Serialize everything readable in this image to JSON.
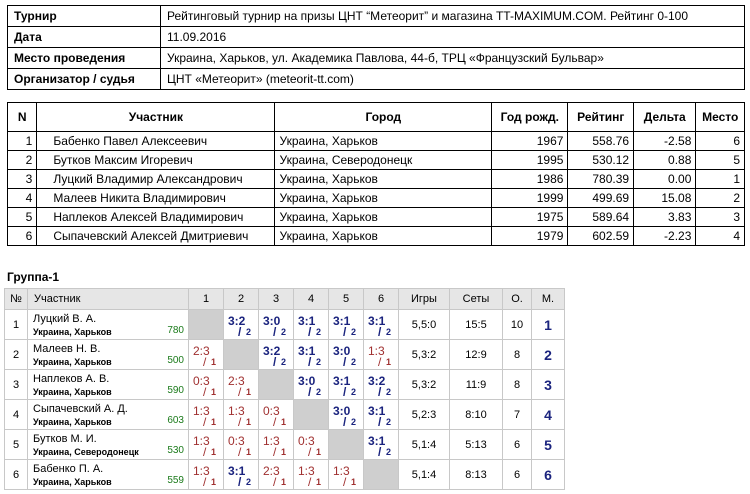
{
  "info": [
    {
      "key": "Турнир",
      "value": "Рейтинговый турнир на призы ЦНТ “Метеорит” и магазина TT-MAXIMUM.COM. Рейтинг 0-100"
    },
    {
      "key": "Дата",
      "value": "11.09.2016"
    },
    {
      "key": "Место проведения",
      "value": "Украина, Харьков, ул. Академика Павлова, 44-б, ТРЦ «Французский Бульвар»"
    },
    {
      "key": "Организатор / судья",
      "value": "ЦНТ «Метеорит» (meteorit-tt.com)"
    }
  ],
  "participants": {
    "headers": [
      "N",
      "Участник",
      "Город",
      "Год рожд.",
      "Рейтинг",
      "Дельта",
      "Место"
    ],
    "rows": [
      [
        "1",
        "Бабенко Павел Алексеевич",
        "Украина, Харьков",
        "1967",
        "558.76",
        "-2.58",
        "6"
      ],
      [
        "2",
        "Бутков Максим Игоревич",
        "Украина, Северодонецк",
        "1995",
        "530.12",
        "0.88",
        "5"
      ],
      [
        "3",
        "Луцкий Владимир Александрович",
        "Украина, Харьков",
        "1986",
        "780.39",
        "0.00",
        "1"
      ],
      [
        "4",
        "Малеев Никита Владимирович",
        "Украина, Харьков",
        "1999",
        "499.69",
        "15.08",
        "2"
      ],
      [
        "5",
        "Наплеков Алексей Владимирович",
        "Украина, Харьков",
        "1975",
        "589.64",
        "3.83",
        "3"
      ],
      [
        "6",
        "Сыпачевский Алексей Дмитриевич",
        "Украина, Харьков",
        "1979",
        "602.59",
        "-2.23",
        "4"
      ]
    ]
  },
  "group": {
    "title": "Группа-1",
    "headers": [
      "№",
      "Участник",
      "1",
      "2",
      "3",
      "4",
      "5",
      "6",
      "Игры",
      "Сеты",
      "О.",
      "М."
    ],
    "rows": [
      {
        "n": "1",
        "name": "Луцкий В. А.",
        "city": "Украина, Харьков",
        "rating": "780",
        "cells": [
          null,
          [
            "3:2",
            "2",
            "w"
          ],
          [
            "3:0",
            "2",
            "w"
          ],
          [
            "3:1",
            "2",
            "w"
          ],
          [
            "3:1",
            "2",
            "w"
          ],
          [
            "3:1",
            "2",
            "w"
          ]
        ],
        "games": "5,5:0",
        "sets": "15:5",
        "o": "10",
        "m": "1"
      },
      {
        "n": "2",
        "name": "Малеев Н. В.",
        "city": "Украина, Харьков",
        "rating": "500",
        "cells": [
          [
            "2:3",
            "1",
            "l"
          ],
          null,
          [
            "3:2",
            "2",
            "w"
          ],
          [
            "3:1",
            "2",
            "w"
          ],
          [
            "3:0",
            "2",
            "w"
          ],
          [
            "1:3",
            "1",
            "l"
          ]
        ],
        "games": "5,3:2",
        "sets": "12:9",
        "o": "8",
        "m": "2"
      },
      {
        "n": "3",
        "name": "Наплеков А. В.",
        "city": "Украина, Харьков",
        "rating": "590",
        "cells": [
          [
            "0:3",
            "1",
            "l"
          ],
          [
            "2:3",
            "1",
            "l"
          ],
          null,
          [
            "3:0",
            "2",
            "w"
          ],
          [
            "3:1",
            "2",
            "w"
          ],
          [
            "3:2",
            "2",
            "w"
          ]
        ],
        "games": "5,3:2",
        "sets": "11:9",
        "o": "8",
        "m": "3"
      },
      {
        "n": "4",
        "name": "Сыпачевский А. Д.",
        "city": "Украина, Харьков",
        "rating": "603",
        "cells": [
          [
            "1:3",
            "1",
            "l"
          ],
          [
            "1:3",
            "1",
            "l"
          ],
          [
            "0:3",
            "1",
            "l"
          ],
          null,
          [
            "3:0",
            "2",
            "w"
          ],
          [
            "3:1",
            "2",
            "w"
          ]
        ],
        "games": "5,2:3",
        "sets": "8:10",
        "o": "7",
        "m": "4"
      },
      {
        "n": "5",
        "name": "Бутков М. И.",
        "city": "Украина, Северодонецк",
        "rating": "530",
        "cells": [
          [
            "1:3",
            "1",
            "l"
          ],
          [
            "0:3",
            "1",
            "l"
          ],
          [
            "1:3",
            "1",
            "l"
          ],
          [
            "0:3",
            "1",
            "l"
          ],
          null,
          [
            "3:1",
            "2",
            "w"
          ]
        ],
        "games": "5,1:4",
        "sets": "5:13",
        "o": "6",
        "m": "5"
      },
      {
        "n": "6",
        "name": "Бабенко П. А.",
        "city": "Украина, Харьков",
        "rating": "559",
        "cells": [
          [
            "1:3",
            "1",
            "l"
          ],
          [
            "3:1",
            "2",
            "w"
          ],
          [
            "2:3",
            "1",
            "l"
          ],
          [
            "1:3",
            "1",
            "l"
          ],
          [
            "1:3",
            "1",
            "l"
          ],
          null
        ],
        "games": "5,1:4",
        "sets": "8:13",
        "o": "6",
        "m": "6"
      }
    ]
  }
}
